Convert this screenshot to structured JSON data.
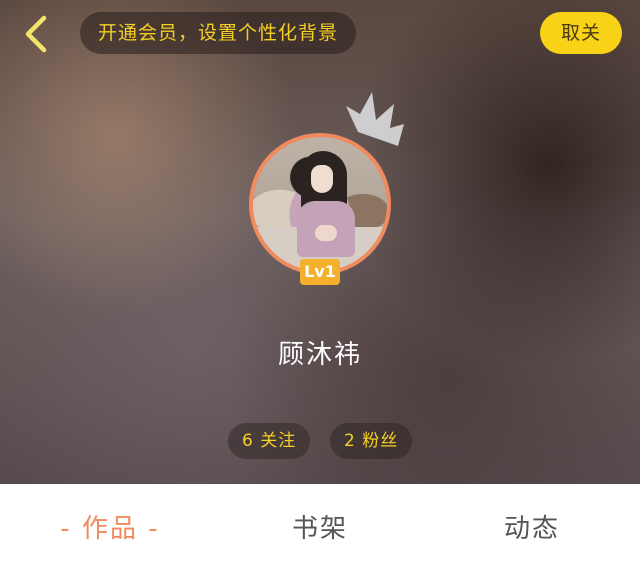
{
  "header": {
    "back_icon": "chevron-left-icon",
    "vip_banner": "开通会员，设置个性化背景",
    "unfollow_label": "取关",
    "accent_color": "#f8d216"
  },
  "profile": {
    "crown_icon": "crown-icon",
    "level": "Lv1",
    "username": "顾沐祎",
    "ring_color": "#f08a5f"
  },
  "stats": {
    "following": "6 关注",
    "fans": "2 粉丝"
  },
  "tabs": {
    "active_color": "#f08a5f",
    "items": [
      {
        "label": "- 作品 -",
        "active": true
      },
      {
        "label": "书架",
        "active": false
      },
      {
        "label": "动态",
        "active": false
      }
    ]
  }
}
